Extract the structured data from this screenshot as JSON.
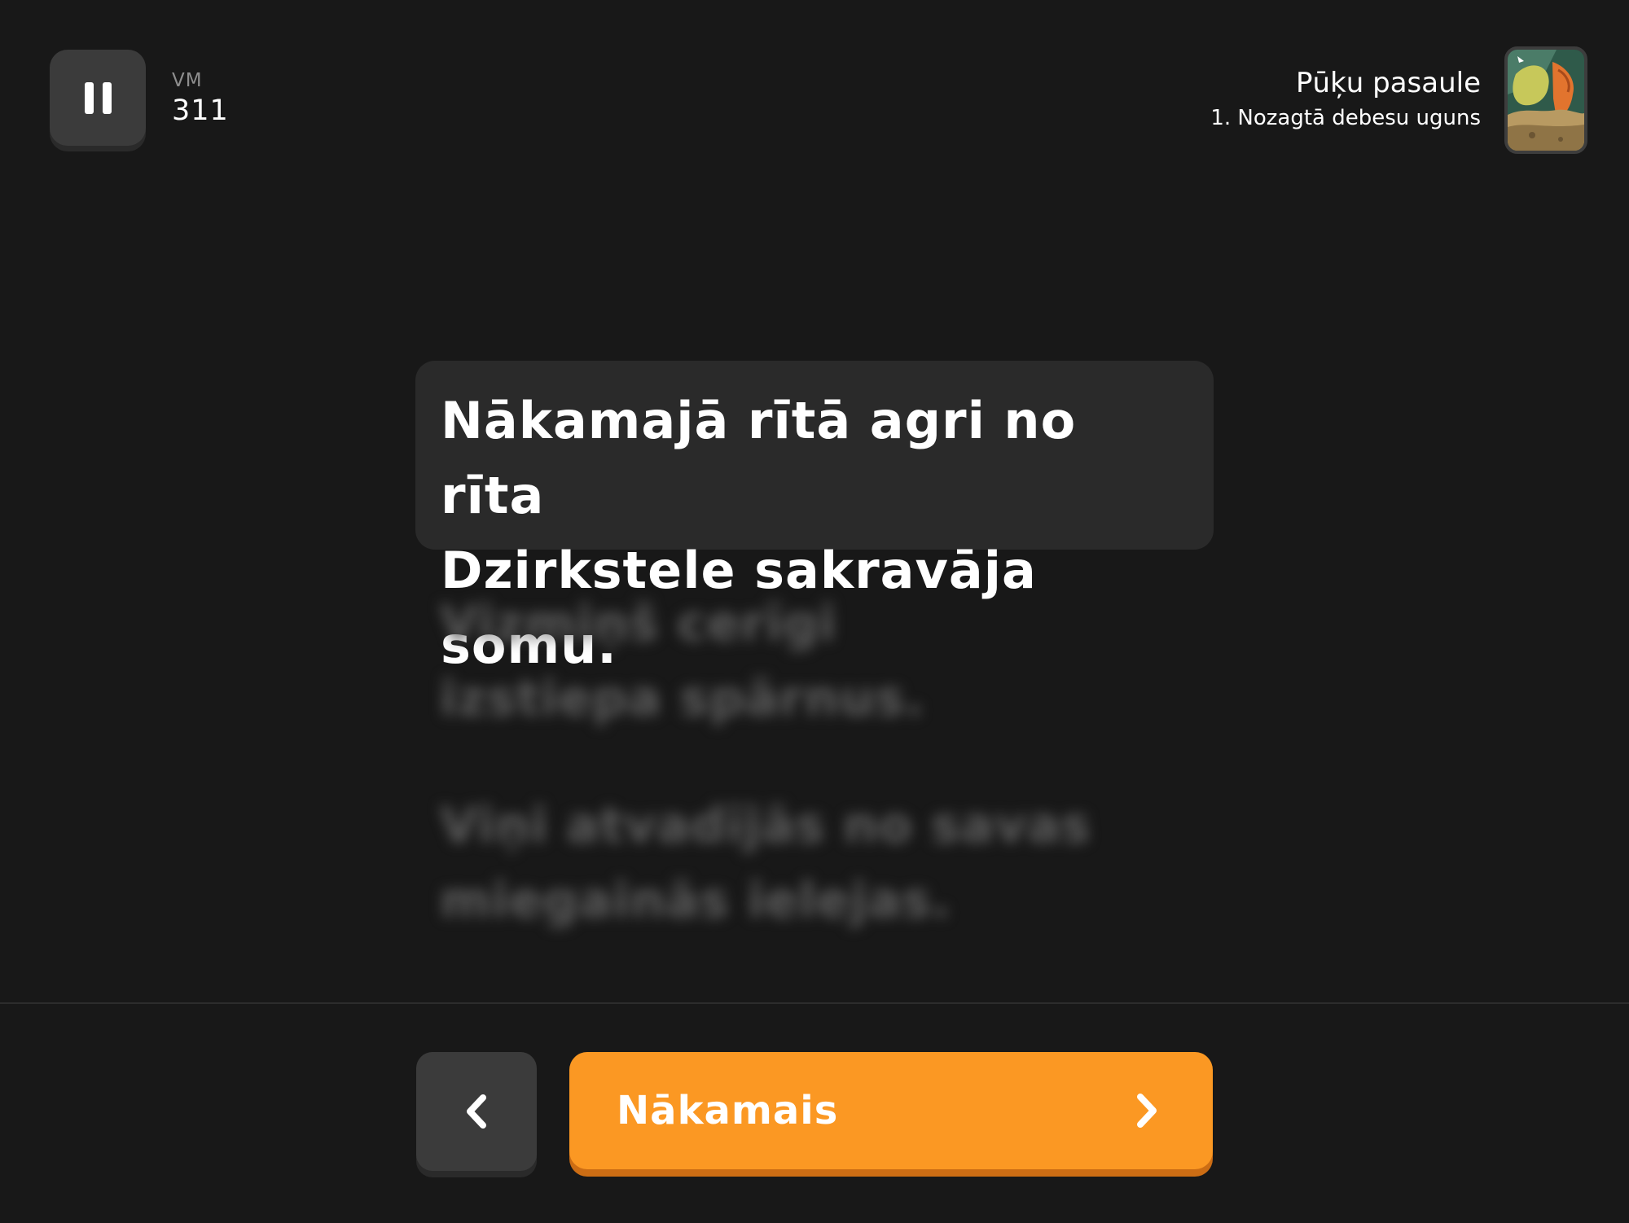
{
  "header": {
    "pause_icon": "pause-icon",
    "level_label": "VM",
    "level_value": "311",
    "book_title": "Pūķu pasaule",
    "chapter_title": "1. Nozagtā debesu uguns",
    "cover_icon": "book-cover-image"
  },
  "story": {
    "current_sentence": "Nākamajā rītā agri no rīta\nDzirkstele sakravāja somu.",
    "upcoming_sentences": [
      "Vizmiņš cerīgi\nizstiepa spārnus.",
      "Viņi atvadījās no savas\nmiegainās ielejas."
    ]
  },
  "footer": {
    "back_icon": "chevron-left-icon",
    "next_label": "Nākamais",
    "next_icon": "chevron-right-icon"
  },
  "colors": {
    "background": "#181818",
    "card": "#2a2a2a",
    "button_dark": "#3b3b3b",
    "accent": "#fb9823",
    "accent_shadow": "#cc6d14"
  }
}
